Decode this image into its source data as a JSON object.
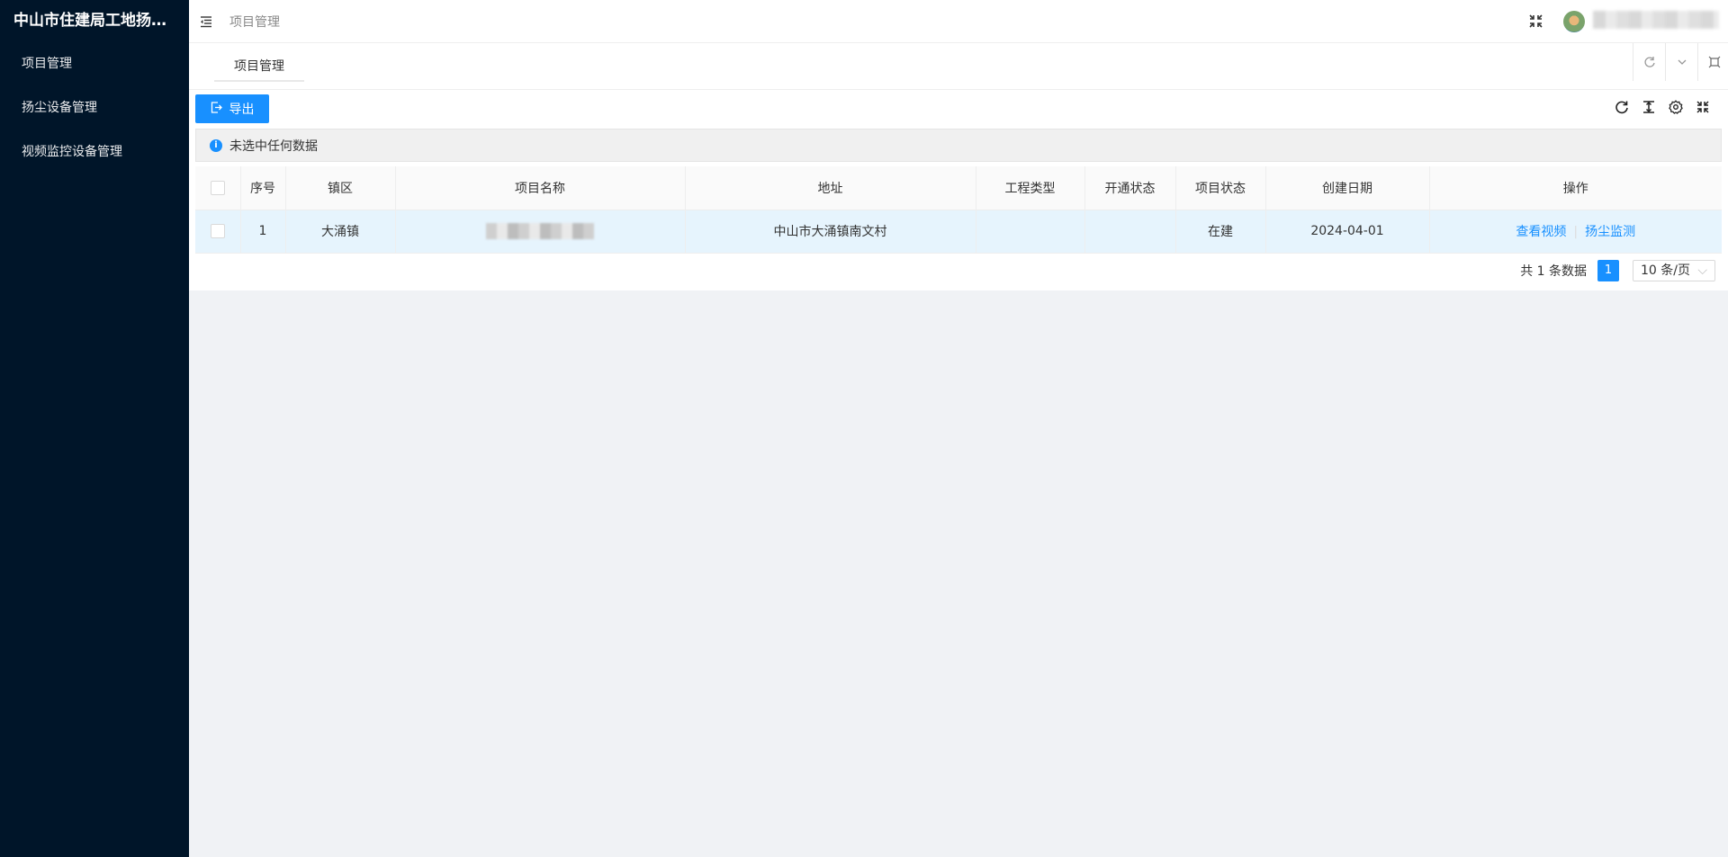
{
  "sidebar": {
    "title": "中山市住建局工地扬尘...",
    "items": [
      {
        "label": "项目管理"
      },
      {
        "label": "扬尘设备管理"
      },
      {
        "label": "视频监控设备管理"
      }
    ]
  },
  "header": {
    "breadcrumb": "项目管理"
  },
  "tabs": [
    {
      "label": "项目管理"
    }
  ],
  "toolbar": {
    "export_label": "导出"
  },
  "alert": {
    "text": "未选中任何数据"
  },
  "table": {
    "columns": [
      "序号",
      "镇区",
      "项目名称",
      "地址",
      "工程类型",
      "开通状态",
      "项目状态",
      "创建日期",
      "操作"
    ],
    "rows": [
      {
        "index": "1",
        "town": "大涌镇",
        "address": "中山市大涌镇南文村",
        "project_type": "",
        "open_status": "",
        "project_status": "在建",
        "created_date": "2024-04-01",
        "actions": [
          "查看视频",
          "扬尘监测"
        ]
      }
    ]
  },
  "pagination": {
    "total_text": "共 1 条数据",
    "current_page": "1",
    "page_size": "10 条/页"
  },
  "colors": {
    "sidebar_bg": "#001529",
    "primary": "#1890ff",
    "selected_row": "#e6f4fd"
  }
}
